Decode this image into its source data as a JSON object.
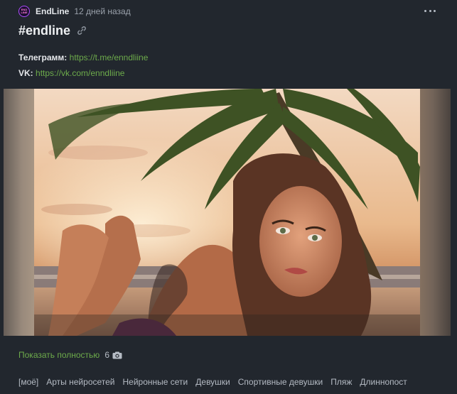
{
  "post": {
    "author": "EndLine",
    "avatar_text": "END LINE",
    "time": "12 дней назад",
    "title": "#endline",
    "telegram_label": "Телеграмм:",
    "telegram_url": "https://t.me/enndliine",
    "vk_label": "VK:",
    "vk_url": "https://vk.com/enndliine",
    "show_full": "Показать полностью",
    "image_count": "6"
  },
  "tags": [
    "[моё]",
    "Арты нейросетей",
    "Нейронные сети",
    "Девушки",
    "Спортивные девушки",
    "Пляж",
    "Длиннопост"
  ],
  "icons": {
    "more": "more-dots-icon",
    "link": "link-icon",
    "camera": "camera-icon"
  },
  "colors": {
    "background": "#22272e",
    "link_green": "#6dab4b",
    "avatar_ring": "#b04cff"
  }
}
